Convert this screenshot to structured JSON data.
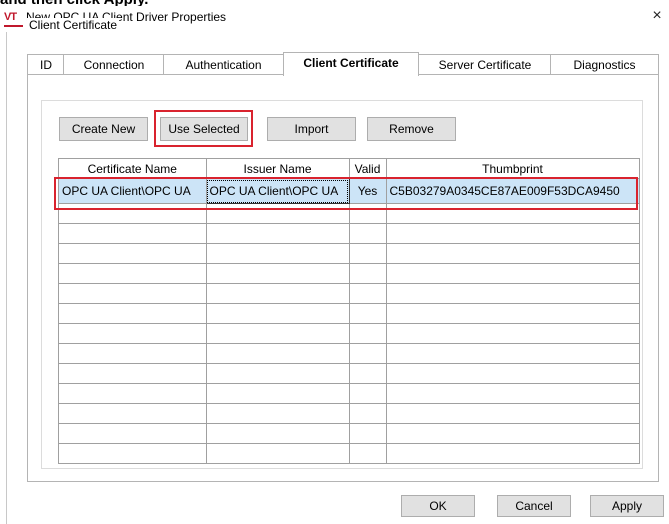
{
  "doc_caption": "and then click Apply.",
  "window": {
    "title": "New OPC UA Client Driver Properties",
    "close_glyph": "×",
    "logo_text": "VT"
  },
  "tabs": [
    {
      "label": "ID",
      "active": false
    },
    {
      "label": "Connection",
      "active": false
    },
    {
      "label": "Authentication",
      "active": false
    },
    {
      "label": "Client Certificate",
      "active": true
    },
    {
      "label": "Server Certificate",
      "active": false
    },
    {
      "label": "Diagnostics",
      "active": false
    }
  ],
  "group": {
    "label": "Client Certificate",
    "buttons": {
      "create_new": "Create New",
      "use_selected": "Use Selected",
      "import": "Import",
      "remove": "Remove"
    }
  },
  "grid": {
    "columns": [
      "Certificate Name",
      "Issuer Name",
      "Valid",
      "Thumbprint"
    ],
    "rows": [
      {
        "name": "OPC UA Client\\OPC UA",
        "issuer": "OPC UA Client\\OPC UA",
        "valid": "Yes",
        "thumbprint": "C5B03279A0345CE87AE009F53DCA9450"
      }
    ]
  },
  "footer": {
    "ok": "OK",
    "cancel": "Cancel",
    "apply": "Apply"
  },
  "colors": {
    "highlight": "#d9232e",
    "selection": "#cce4f7",
    "logo": "#c0182c"
  }
}
